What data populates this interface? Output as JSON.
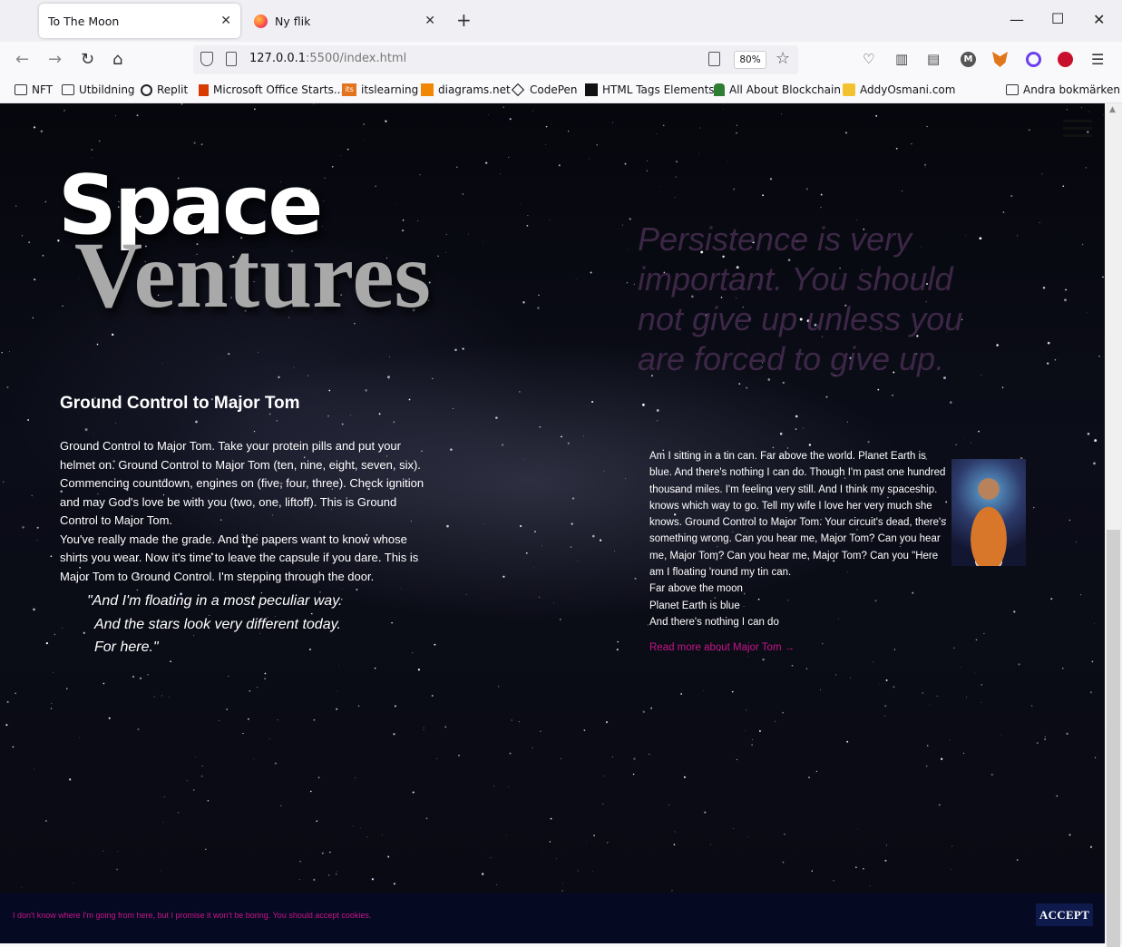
{
  "browser": {
    "tabs": [
      {
        "title": "To The Moon",
        "active": true
      },
      {
        "title": "Ny flik",
        "active": false
      }
    ],
    "url": {
      "host": "127.0.0.1",
      "rest": ":5500/index.html"
    },
    "zoom": "80%",
    "bookmarks": [
      "NFT",
      "Utbildning",
      "Replit",
      "Microsoft Office Starts...",
      "itslearning",
      "diagrams.net",
      "CodePen",
      "HTML Tags Elements",
      "All About Blockchain",
      "AddyOsmani.com"
    ],
    "other_bookmarks": "Andra bokmärken"
  },
  "page": {
    "brand": {
      "line1": "Space",
      "line2": "Ventures"
    },
    "big_quote": "Persistence is very important. You should not give up unless you are forced to give up.",
    "section_title": "Ground Control to Major Tom",
    "lyrics_p1": "Ground Control to Major Tom. Take your protein pills and put your helmet on. Ground Control to Major Tom (ten, nine, eight, seven, six). Commencing countdown, engines on (five, four, three). Check ignition and may God's love be with you (two, one, liftoff). This is Ground Control to Major Tom.",
    "lyrics_p2": "You've really made the grade. And the papers want to know whose shirts you wear. Now it's time to leave the capsule if you dare. This is Major Tom to Ground Control. I'm stepping through the door.",
    "blockquote": {
      "line1": "\"And I'm floating in a most peculiar way.",
      "line2": "And the stars look very different today.",
      "line3": "For here.\""
    },
    "right_text": "Am I sitting in a tin can. Far above the world. Planet Earth is blue. And there's nothing I can do. Though I'm past one hundred thousand miles. I'm feeling very still. And I think my spaceship. knows which way to go. Tell my wife I love her very much she knows. Ground Control to Major Tom. Your circuit's dead, there's something wrong. Can you hear me, Major Tom? Can you hear me, Major Tom? Can you hear me, Major Tom? Can you \"Here am I floating 'round my tin can.",
    "right_lines": [
      "Far above the moon",
      "Planet Earth is blue",
      "And there's nothing I can do"
    ],
    "read_more": "Read more about Major Tom →",
    "cookie": {
      "text": "I don't know where I'm going from here, but I promise it won't be boring. You should accept cookies.",
      "accept": "ACCEPT"
    }
  },
  "colors": {
    "accent_pink": "#c7148a",
    "cookie_bg": "#050a22",
    "accept_bg": "#0e1a4b",
    "brand_gray": "#a9a9a9"
  }
}
